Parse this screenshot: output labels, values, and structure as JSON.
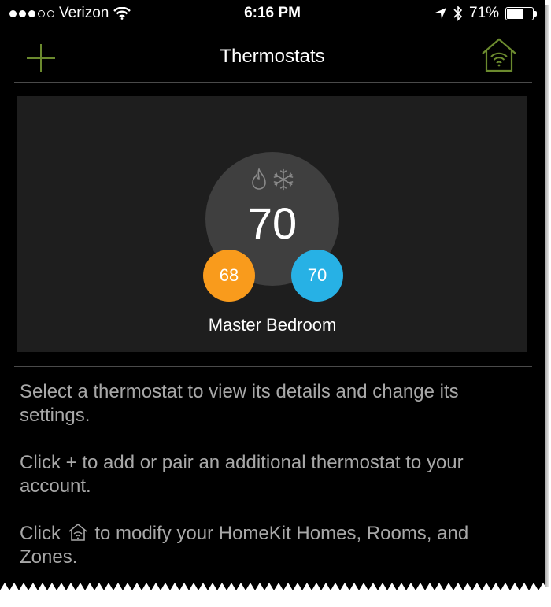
{
  "status_bar": {
    "carrier": "Verizon",
    "time": "6:16 PM",
    "battery_percent": "71%",
    "battery_level": 0.71,
    "signal_bars_filled": 3,
    "signal_bars_total": 5
  },
  "nav": {
    "title": "Thermostats",
    "add_icon": "plus-icon",
    "home_icon": "home-wifi-icon",
    "accent_color": "#6b8a2e"
  },
  "thermostat": {
    "current_temp": "70",
    "heat_setpoint": "68",
    "cool_setpoint": "70",
    "room_name": "Master Bedroom",
    "mode_icons": [
      "flame-icon",
      "snowflake-icon"
    ],
    "heat_color": "#f99b1c",
    "cool_color": "#27b1e5"
  },
  "help": {
    "line1": "Select a thermostat to view its details and change its settings.",
    "line2": "Click + to add or pair an additional thermostat to your account.",
    "line3_prefix": "Click",
    "line3_suffix": "to modify your HomeKit Homes, Rooms, and Zones."
  }
}
